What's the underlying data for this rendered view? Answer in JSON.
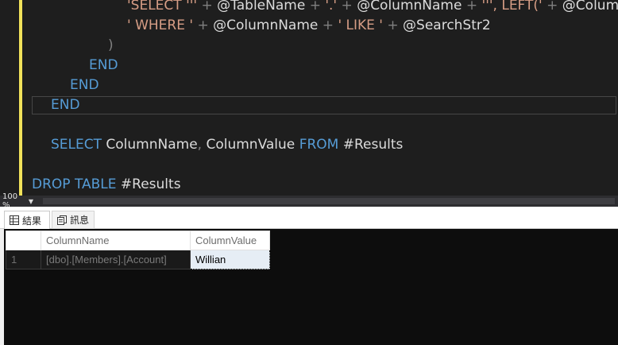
{
  "editor": {
    "lines": [
      {
        "tokens": [
          {
            "t": "'SELECT '''",
            "c": "str"
          },
          {
            "t": " + ",
            "c": "op"
          },
          {
            "t": "@TableName",
            "c": "pl"
          },
          {
            "t": " + ",
            "c": "op"
          },
          {
            "t": "'.'",
            "c": "str"
          },
          {
            "t": " + ",
            "c": "op"
          },
          {
            "t": "@ColumnName",
            "c": "pl"
          },
          {
            "t": " + ",
            "c": "op"
          },
          {
            "t": "''', LEFT('",
            "c": "str"
          },
          {
            "t": " + ",
            "c": "op"
          },
          {
            "t": "@Colum",
            "c": "pl"
          }
        ]
      },
      {
        "tokens": [
          {
            "t": "' WHERE '",
            "c": "str"
          },
          {
            "t": " + ",
            "c": "op"
          },
          {
            "t": "@ColumnName",
            "c": "pl"
          },
          {
            "t": " + ",
            "c": "op"
          },
          {
            "t": "' LIKE '",
            "c": "str"
          },
          {
            "t": " + ",
            "c": "op"
          },
          {
            "t": "@SearchStr2",
            "c": "pl"
          }
        ]
      },
      {
        "tokens": [
          {
            "t": ")",
            "c": "op"
          }
        ]
      },
      {
        "tokens": [
          {
            "t": "END",
            "c": "kw"
          }
        ]
      },
      {
        "tokens": [
          {
            "t": "END",
            "c": "kw"
          }
        ]
      },
      {
        "tokens": [
          {
            "t": "END",
            "c": "kw"
          }
        ]
      },
      {
        "tokens": []
      },
      {
        "tokens": [
          {
            "t": "SELECT",
            "c": "kw"
          },
          {
            "t": " ColumnName",
            "c": "pl"
          },
          {
            "t": ",",
            "c": "op"
          },
          {
            "t": " ColumnValue ",
            "c": "pl"
          },
          {
            "t": "FROM",
            "c": "kw"
          },
          {
            "t": " #Results",
            "c": "pl"
          }
        ]
      },
      {
        "tokens": []
      },
      {
        "tokens": [
          {
            "t": "DROP TABLE",
            "c": "kw"
          },
          {
            "t": " #Results",
            "c": "pl"
          }
        ]
      }
    ]
  },
  "statusbar": {
    "zoom": "100 %"
  },
  "results": {
    "tabs": [
      {
        "label": "結果",
        "icon": "grid-icon"
      },
      {
        "label": "訊息",
        "icon": "messages-icon"
      }
    ],
    "columns": [
      "ColumnName",
      "ColumnValue"
    ],
    "rows": [
      {
        "num": "1",
        "cells": [
          "[dbo].[Members].[Account]",
          "Willian"
        ]
      }
    ]
  },
  "colors": {
    "keyword": "#569cd6",
    "string": "#d69d85",
    "operator": "#808080",
    "text": "#dcdcdc",
    "change_marker": "#f1e25a",
    "editor_background": "#1e1e1e"
  }
}
